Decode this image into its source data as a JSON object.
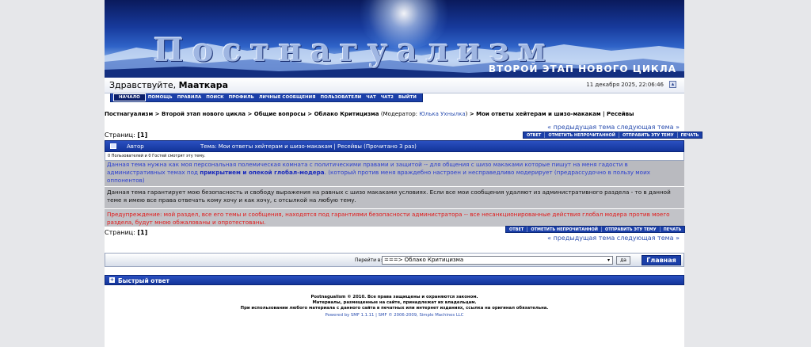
{
  "banner": {
    "title": "Постнагуализм",
    "subtitle": "ВТОРОЙ ЭТАП НОВОГО ЦИКЛА"
  },
  "greeting": {
    "prefix": "Здравствуйте,",
    "username": "Мааткара",
    "datetime": "11 декабря 2025, 22:06:46"
  },
  "menu": [
    "НАЧАЛО",
    "ПОМОЩЬ",
    "ПРАВИЛА",
    "ПОИСК",
    "ПРОФИЛЬ",
    "ЛИЧНЫЕ СООБЩЕНИЯ",
    "ПОЛЬЗОВАТЕЛИ",
    "ЧАТ",
    "ЧАТ2",
    "ВЫЙТИ"
  ],
  "breadcrumb": {
    "items": [
      "Постнагуализм",
      "Второй этап нового цикла",
      "Общие вопросы",
      "Облако Критицизма"
    ],
    "moderator_label": "(Модератор:",
    "moderator_name": "Юлька Ухнылка",
    "moderator_close": ")",
    "current": "Мои ответы хейтерам и шизо-макакам | Ресейвы",
    "sep": " > "
  },
  "pagination": {
    "label": "Страниц:",
    "current": "[1]"
  },
  "prevnext": "« предыдущая тема следующая тема »",
  "topic_buttons": [
    "ОТВЕТ",
    "ОТМЕТИТЬ НЕПРОЧИТАННОЙ",
    "ОТПРАВИТЬ ЭТУ ТЕМУ",
    "ПЕЧАТЬ"
  ],
  "topic_header": {
    "author_label": "Автор",
    "title": "Тема: Мои ответы хейтерам и шизо-макакам | Ресейвы  (Прочитано 3 раз)"
  },
  "viewers": "0 Пользователей и 0 Гостей смотрят эту тему.",
  "messages": {
    "m1_a": "Данная тема нужна как моя персональная полемическая комната с политическими правами и защитой -- для общения с шизо макаками которые пишут на меня гадости в административных темах под ",
    "m1_bold": "прикрытием и опекой глобал-модера",
    "m1_b": ". (который против меня враждебно настроен и несправедливо модерирует (предрассудочно в пользу моих оппонентов)",
    "m2": "Данная тема гарантирует мою безопасность и свободу выражения на равных с шизо макаками условиях. Если все мои сообщения удаляют из административного раздела - то в данной теме я имею все права отвечать кому хочу и как хочу, с отсылкой на любую тему.",
    "m3": "Предупреждение: мой раздел, все его темы и сообщения, находятся под гарантиями безопасности администратора -- все несанкционированные действия глобал модера против моего раздела, будут мною обжалованы и опротестованы."
  },
  "jump": {
    "label": "Перейти в:",
    "selected": "===> Облако Критицизма",
    "go": "да",
    "home": "Главная"
  },
  "quick_reply": "Быстрый ответ",
  "footer": {
    "line1": "Postnagualism © 2010. Все права защищены и охраняются законом.",
    "line2": "Материалы, размещенные на сайте, принадлежат их владельцам.",
    "line3": "При использовании любого материала с данного сайта в печатных или интернет изданиях, ссылка на оригинал обязательна.",
    "powered": "Powered by SMF 1.1.11 | SMF © 2006-2009, Simple Machines LLC"
  },
  "colors": {
    "accent": "#1b3fa8",
    "link": "#2b4fb0",
    "warning": "#e01a1a",
    "page_bg": "#e6e7ea"
  }
}
